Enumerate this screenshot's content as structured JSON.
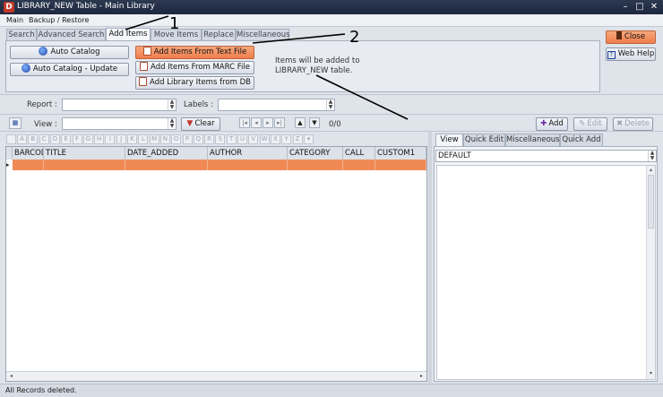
{
  "window": {
    "title": "LIBRARY_NEW Table - Main Library",
    "icon_letter": "D"
  },
  "menu": [
    "Main",
    "Backup / Restore"
  ],
  "tabs": [
    "Search",
    "Advanced Search",
    "Add Items",
    "Move Items",
    "Replace",
    "Miscellaneous"
  ],
  "active_tab": "Add Items",
  "add_items": {
    "auto_catalog": "Auto Catalog",
    "auto_catalog_update": "Auto Catalog - Update",
    "from_text": "Add Items From Text File",
    "from_marc": "Add Items From MARC File",
    "from_db": "Add Library Items from DB",
    "info_line1": "Items will be added to",
    "info_line2": "LIBRARY_NEW table."
  },
  "close_label": "Close",
  "help_label": "Web Help",
  "report_label": "Report :",
  "labels_label": "Labels :",
  "view_label": "View :",
  "clear_label": "Clear",
  "record_count": "0/0",
  "add_label": "Add",
  "edit_label": "Edit",
  "delete_label": "Delete",
  "letters": [
    "A",
    "B",
    "C",
    "D",
    "E",
    "F",
    "G",
    "H",
    "I",
    "J",
    "K",
    "L",
    "M",
    "N",
    "O",
    "P",
    "Q",
    "R",
    "S",
    "T",
    "U",
    "V",
    "W",
    "X",
    "Y",
    "Z"
  ],
  "columns": [
    "BARCODE",
    "TITLE",
    "DATE_ADDED",
    "AUTHOR",
    "CATEGORY",
    "CALL",
    "CUSTOM1"
  ],
  "right_tabs": [
    "View",
    "Quick Edit",
    "Miscellaneous",
    "Quick Add"
  ],
  "view_select": "DEFAULT",
  "status": "All Records deleted.",
  "annotations": [
    "1",
    "2"
  ]
}
